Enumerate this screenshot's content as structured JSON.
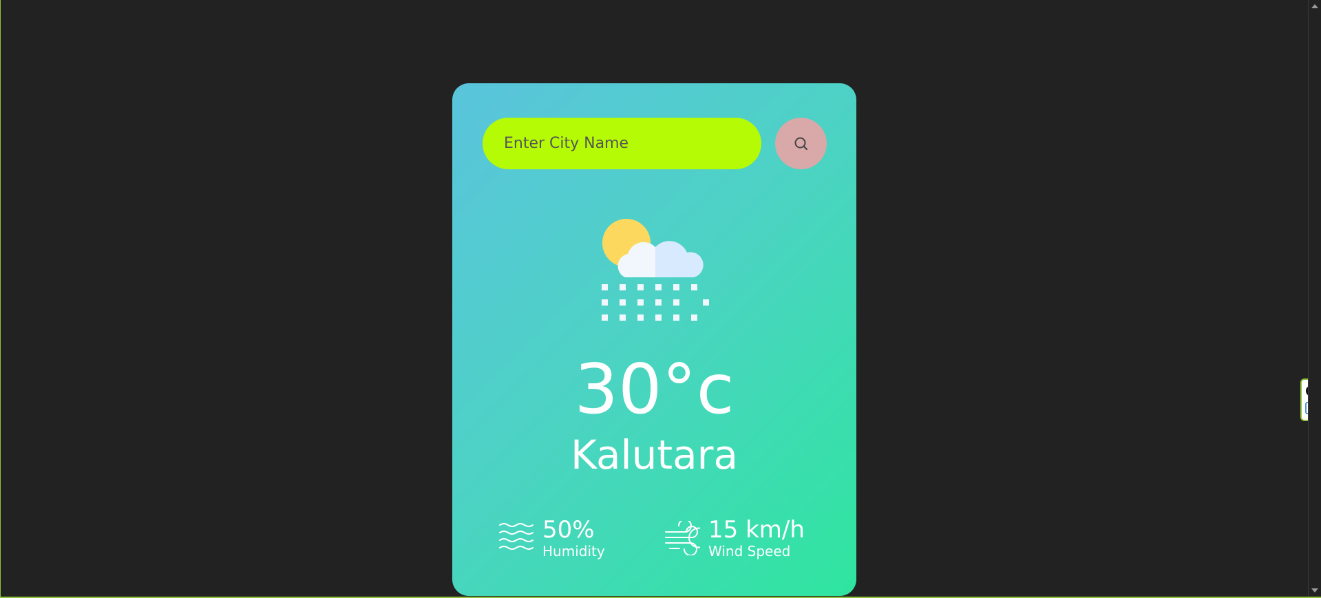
{
  "search": {
    "placeholder": "Enter City Name"
  },
  "weather": {
    "temperature": "30°c",
    "city": "Kalutara",
    "icon": "sun-cloud-snow-icon"
  },
  "details": {
    "humidity": {
      "value": "50%",
      "label": "Humidity",
      "icon": "humidity-waves-icon"
    },
    "wind": {
      "value": "15 km/h",
      "label": "Wind Speed",
      "icon": "wind-icon"
    }
  },
  "colors": {
    "page_background": "#222222",
    "card_gradient_start": "#5ac4dc",
    "card_gradient_end": "#2fe59f",
    "search_input_bg": "#b6fb06",
    "search_button_bg": "#d9a8a8"
  }
}
